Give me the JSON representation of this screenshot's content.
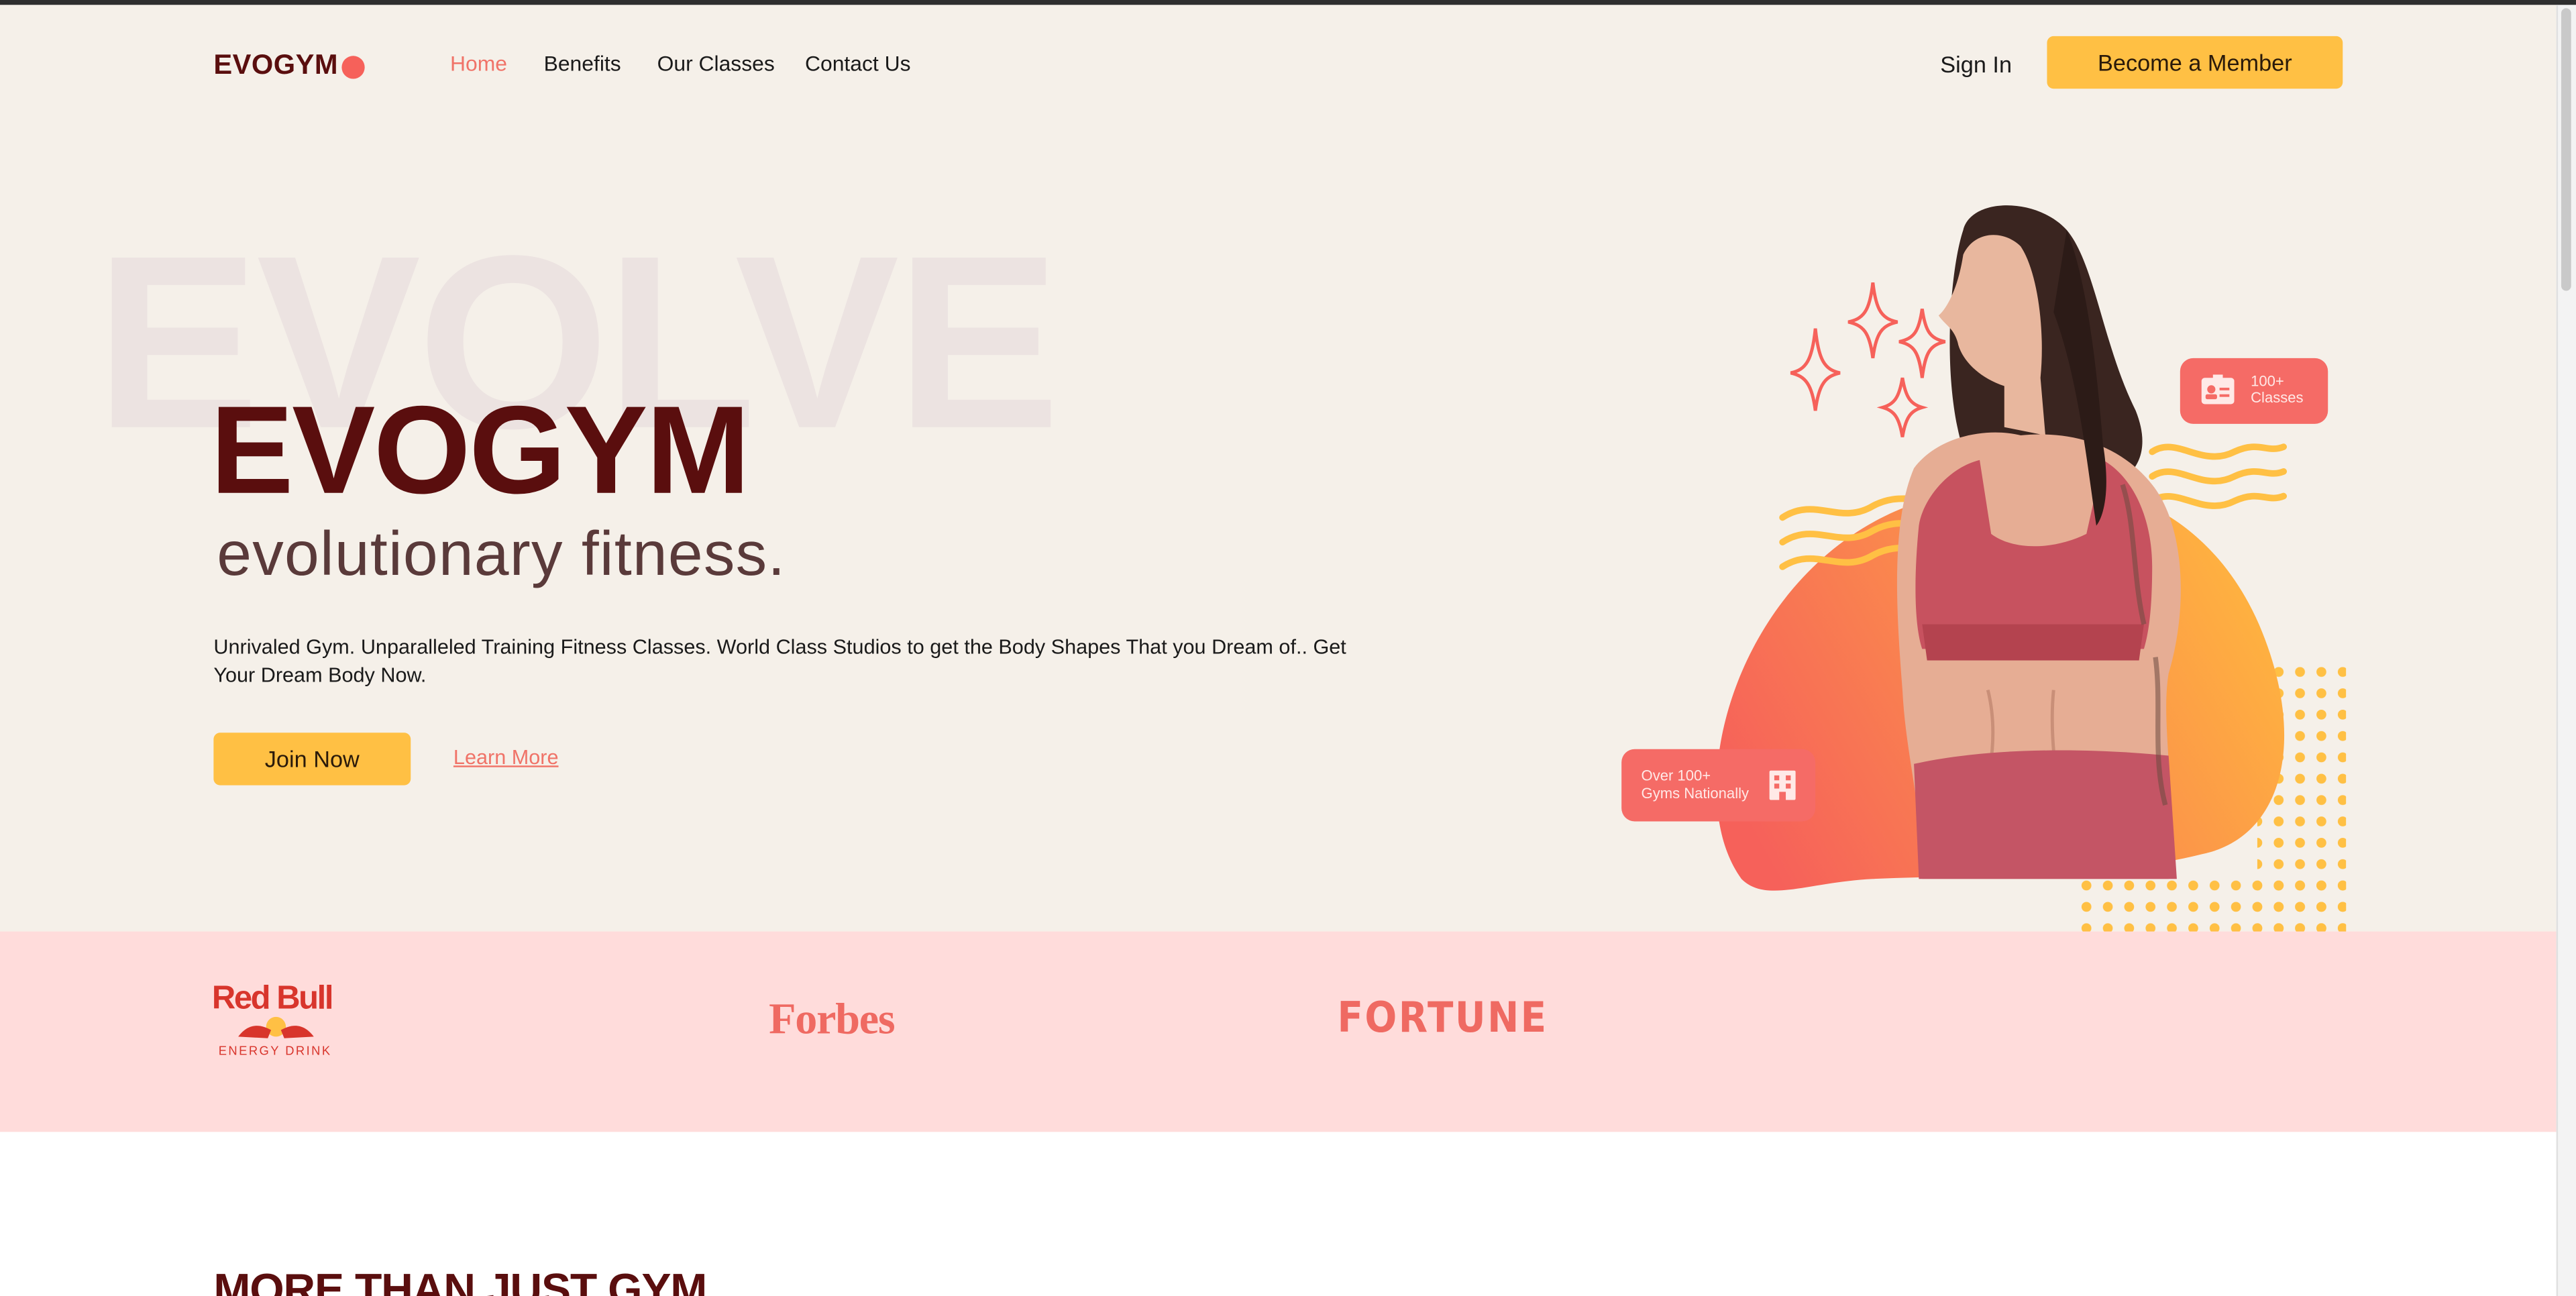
{
  "brand": {
    "name": "EVOGYM"
  },
  "nav": {
    "items": [
      {
        "label": "Home",
        "active": true
      },
      {
        "label": "Benefits"
      },
      {
        "label": "Our Classes"
      },
      {
        "label": "Contact Us"
      }
    ],
    "sign_in": "Sign In",
    "cta": "Become a Member"
  },
  "hero": {
    "background_word": "EVOLVE",
    "title": "EVOGYM",
    "subtitle": "evolutionary fitness.",
    "description": "Unrivaled Gym. Unparalleled Training Fitness Classes. World Class Studios to get the Body Shapes That you Dream of.. Get Your Dream Body Now.",
    "join_label": "Join Now",
    "learn_more_label": "Learn More",
    "badges": {
      "classes_line1": "100+",
      "classes_line2": "Classes",
      "gyms_line1": "Over 100+",
      "gyms_line2": "Gyms Nationally"
    }
  },
  "sponsors": {
    "redbull": "Red Bull",
    "redbull_sub": "ENERGY DRINK",
    "forbes": "Forbes",
    "fortune": "FORTUNE"
  },
  "next_section": {
    "title": "MORE THAN JUST GYM"
  },
  "colors": {
    "primary": "#ffc044",
    "accent": "#f6615a",
    "dark": "#5a0e0e",
    "hero_bg": "#f5f0e9",
    "sponsor_bg": "#ffdcdb"
  }
}
